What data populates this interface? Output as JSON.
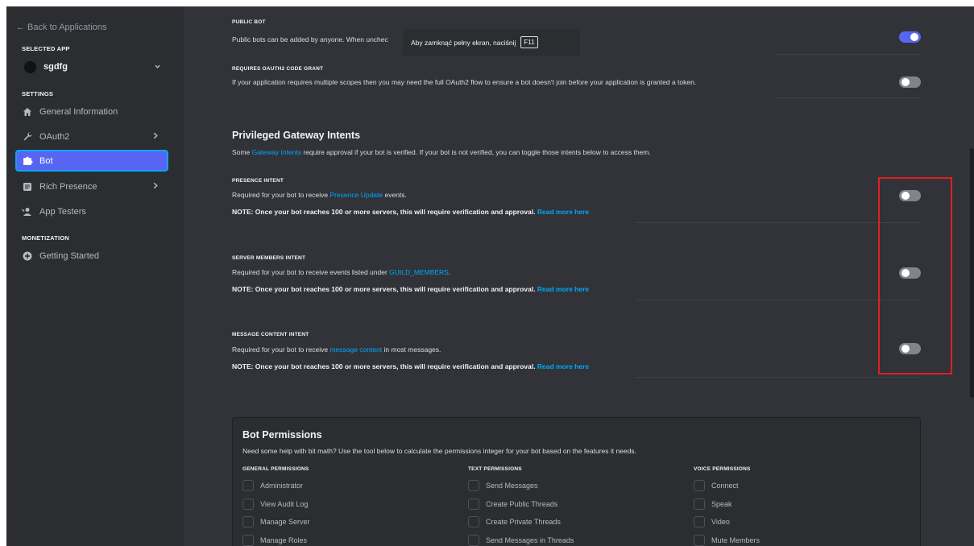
{
  "sidebar": {
    "back_label": "← Back to Applications",
    "selected_app_heading": "SELECTED APP",
    "app_name": "sgdfg",
    "settings_heading": "SETTINGS",
    "monetization_heading": "MONETIZATION",
    "items": [
      {
        "label": "General Information",
        "icon": "home-icon"
      },
      {
        "label": "OAuth2",
        "icon": "wrench-icon"
      },
      {
        "label": "Bot",
        "icon": "puzzle-icon"
      },
      {
        "label": "Rich Presence",
        "icon": "document-icon"
      },
      {
        "label": "App Testers",
        "icon": "person-add-icon"
      },
      {
        "label": "Getting Started",
        "icon": "plus-circle-icon"
      }
    ]
  },
  "public_bot": {
    "label": "PUBLIC BOT",
    "desc": "Public bots can be added by anyone. When unchec",
    "enabled": true
  },
  "oauth_grant": {
    "label": "REQUIRES OAUTH2 CODE GRANT",
    "desc": "If your application requires multiple scopes then you may need the full OAuth2 flow to ensure a bot doesn't join before your application is granted a token.",
    "enabled": false
  },
  "fullscreen_tooltip": {
    "text": "Aby zamknąć pełny ekran, naciśnij",
    "key": "F11"
  },
  "intents": {
    "heading": "Privileged Gateway Intents",
    "desc_pre": "Some ",
    "desc_link": "Gateway Intents",
    "desc_post": " require approval if your bot is verified. If your bot is not verified, you can toggle those intents below to access them.",
    "note_text": "NOTE: Once your bot reaches 100 or more servers, this will require verification and approval.",
    "read_more": "Read more here",
    "presence": {
      "label": "PRESENCE INTENT",
      "pre": "Required for your bot to receive ",
      "link": "Presence Update",
      "post": " events.",
      "enabled": false
    },
    "members": {
      "label": "SERVER MEMBERS INTENT",
      "pre": "Required for your bot to receive events listed under ",
      "link": "GUILD_MEMBERS",
      "post": ".",
      "enabled": false
    },
    "message": {
      "label": "MESSAGE CONTENT INTENT",
      "pre": "Required for your bot to receive ",
      "link": "message content",
      "post": " in most messages.",
      "enabled": false
    }
  },
  "permissions": {
    "title": "Bot Permissions",
    "desc": "Need some help with bit math? Use the tool below to calculate the permissions integer for your bot based on the features it needs.",
    "general": {
      "head": "GENERAL PERMISSIONS",
      "items": [
        "Administrator",
        "View Audit Log",
        "Manage Server",
        "Manage Roles"
      ]
    },
    "text": {
      "head": "TEXT PERMISSIONS",
      "items": [
        "Send Messages",
        "Create Public Threads",
        "Create Private Threads",
        "Send Messages in Threads"
      ]
    },
    "voice": {
      "head": "VOICE PERMISSIONS",
      "items": [
        "Connect",
        "Speak",
        "Video",
        "Mute Members"
      ]
    }
  },
  "colors": {
    "accent": "#5865f2",
    "link": "#00a8fc",
    "highlight": "#e02020"
  }
}
